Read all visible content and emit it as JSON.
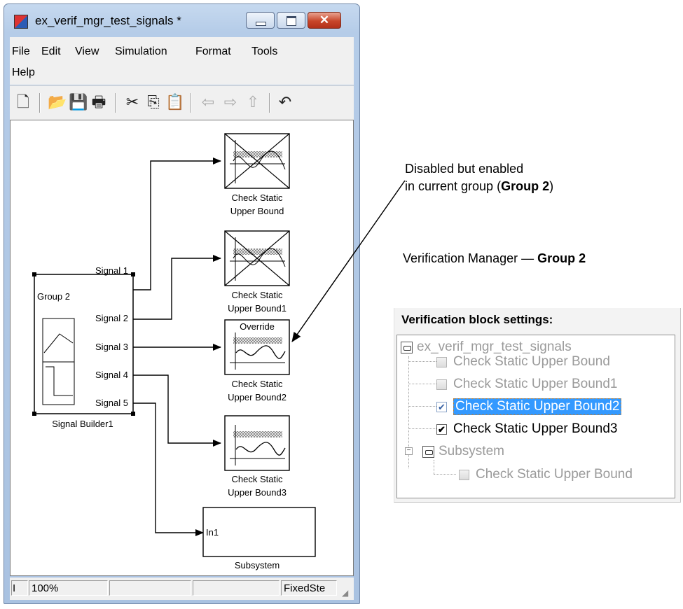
{
  "window": {
    "title": "ex_verif_mgr_test_signals *",
    "menu": [
      "File",
      "Edit",
      "View",
      "Simulation",
      "Format",
      "Tools",
      "Help"
    ],
    "toolbar_icons": [
      "new-icon",
      "open-icon",
      "save-icon",
      "print-icon",
      "cut-icon",
      "copy-icon",
      "paste-icon",
      "back-icon",
      "forward-icon",
      "up-icon",
      "undo-icon"
    ],
    "status": {
      "cell1": "I",
      "zoom": "100%",
      "cell3": "",
      "cell4": "",
      "solver": "FixedSte"
    }
  },
  "model": {
    "signal_builder": {
      "group_label": "Group 2",
      "name": "Signal Builder1",
      "ports": [
        "Signal 1",
        "Signal 2",
        "Signal 3",
        "Signal 4",
        "Signal 5"
      ]
    },
    "blocks": [
      {
        "line1": "Check Static",
        "line2": "Upper Bound"
      },
      {
        "line1": "Check Static",
        "line2": "Upper Bound1"
      },
      {
        "line1": "Check Static",
        "line2": "Upper Bound2",
        "overlay": "Override"
      },
      {
        "line1": "Check Static",
        "line2": "Upper Bound3"
      }
    ],
    "subsystem": {
      "port": "In1",
      "name": "Subsystem"
    }
  },
  "annotations": {
    "callout_line1": "Disabled but enabled",
    "callout_line2_prefix": "in current group (",
    "callout_line2_bold": "Group 2",
    "callout_line2_suffix": ")",
    "vm_caption_prefix": "Verification Manager — ",
    "vm_caption_bold": "Group 2"
  },
  "verification_manager": {
    "header": "Verification block settings:",
    "tree": [
      {
        "label": "ex_verif_mgr_test_signals",
        "kind": "model",
        "state": "disabled"
      },
      {
        "label": "Check Static  Upper Bound",
        "checked": false,
        "state": "disabled"
      },
      {
        "label": "Check Static  Upper Bound1",
        "checked": false,
        "state": "disabled"
      },
      {
        "label": "Check Static  Upper Bound2",
        "checked": true,
        "state": "selected"
      },
      {
        "label": "Check Static  Upper Bound3",
        "checked": true,
        "state": "enabled"
      },
      {
        "label": "Subsystem",
        "kind": "subsystem",
        "state": "disabled",
        "expander": "−"
      },
      {
        "label": "Check Static  Upper Bound",
        "checked": false,
        "state": "disabled"
      }
    ],
    "check_glyph": "✔"
  }
}
